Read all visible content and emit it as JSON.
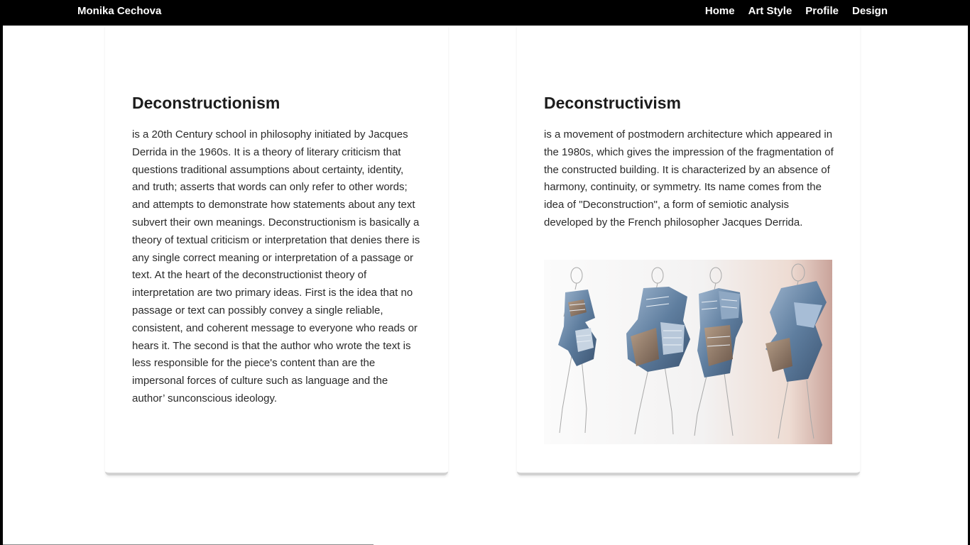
{
  "navbar": {
    "brand": "Monika Cechova",
    "links": [
      "Home",
      "Art Style",
      "Profile",
      "Design"
    ]
  },
  "cards": [
    {
      "title": "Deconstructionism",
      "text": "is a 20th Century school in philosophy initiated by Jacques Derrida in the 1960s. It is a theory of literary criticism that questions traditional assumptions about certainty, identity, and truth; asserts that words can only refer to other words; and attempts to demonstrate how statements about any text subvert their own meanings. Deconstructionism is basically a theory of textual criticism or interpretation that denies there is any single correct meaning or interpretation of a passage or text. At the heart of the deconstructionist theory of interpretation are two primary ideas. First is the idea that no passage or text can possibly convey a single reliable, consistent, and coherent message to everyone who reads or hears it. The second is that the author who wrote the text is less responsible for the piece's content than are the impersonal forces of culture such as language and the author’ sunconscious ideology."
    },
    {
      "title": "Deconstructivism",
      "text": "is a movement of postmodern architecture which appeared in the 1980s, which gives the impression of the fragmentation of the constructed building. It is characterized by an absence of harmony, continuity, or symmetry. Its name comes from the idea of \"Deconstruction\", a form of semiotic analysis developed by the French philosopher Jacques Derrida."
    }
  ],
  "colors": {
    "navbar_bg": "#000000",
    "page_bg": "#ffffff",
    "text": "#2a2a2a"
  }
}
